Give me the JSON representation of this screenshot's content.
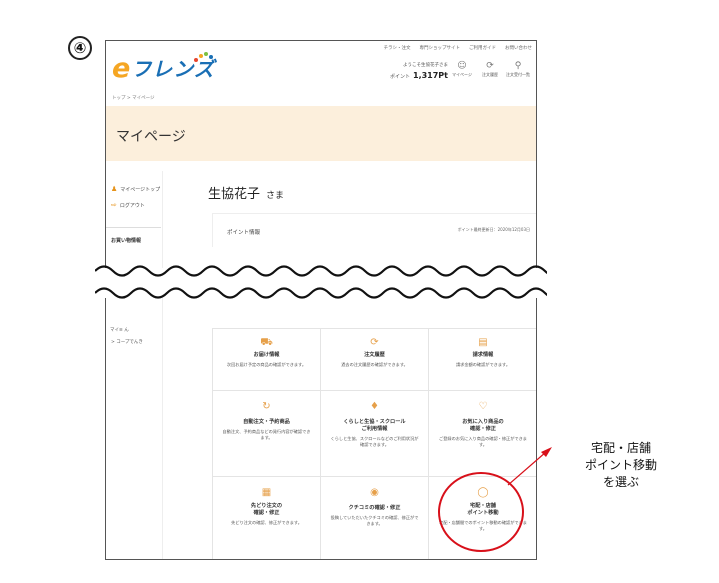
{
  "step_number": "④",
  "logo": {
    "e": "e",
    "rest": "フレンズ"
  },
  "header": {
    "top_links": [
      "チラシ・注文",
      "専門ショップサイト",
      "ご利用ガイド",
      "お問い合わせ"
    ],
    "greeting": "ようこそ生協花子さま",
    "points_label": "ポイント",
    "points_value": "1,317Pt",
    "icons": [
      {
        "icon": "user-icon",
        "label": "マイページ"
      },
      {
        "icon": "history-icon",
        "label": "注文履歴"
      },
      {
        "icon": "cart-icon",
        "label": "注文受付一覧"
      }
    ]
  },
  "breadcrumb": "トップ > マイページ",
  "banner_title": "マイページ",
  "sidebar": {
    "links": [
      {
        "icon": "person-icon",
        "label": "マイページトップ"
      },
      {
        "icon": "logout-icon",
        "label": "ログアウト"
      }
    ],
    "category": "お買い物情報",
    "category2": "マイ≡ ん",
    "coop_link": "> コープでんき"
  },
  "member": {
    "name": "生協花子",
    "honorific": "さま"
  },
  "point_info": {
    "title": "ポイント情報",
    "date": "ポイント最終更新日：2020年12月03日"
  },
  "menu": [
    {
      "icon": "truck-icon",
      "title": "お届け情報",
      "desc": "次回お届け予定の商品の確認ができます。"
    },
    {
      "icon": "history-icon",
      "title": "注文履歴",
      "desc": "過去の注文履歴の確認ができます。"
    },
    {
      "icon": "invoice-icon",
      "title": "請求情報",
      "desc": "請求金額の確認ができます。"
    },
    {
      "icon": "repeat-icon",
      "title": "自動注文・予約商品",
      "desc": "自動注文、予約商品などの発行内容が確認できます。"
    },
    {
      "icon": "bag-icon",
      "title": "くらしと生協・スクロール\nご利用情報",
      "desc": "くらしと生協、スクロールなどのご利用状況が確認できます。"
    },
    {
      "icon": "heart-icon",
      "title": "お気に入り商品の\n確認・修正",
      "desc": "ご登録のお気に入り商品の確認・修正ができます。"
    },
    {
      "icon": "calendar-icon",
      "title": "先どり注文の\n確認・修正",
      "desc": "先どり注文の確認、修正ができます。"
    },
    {
      "icon": "chat-icon",
      "title": "クチコミの確認・修正",
      "desc": "投稿していただいたクチコミの確認、修正ができます。"
    },
    {
      "icon": "point-icon",
      "title": "宅配・店舗\nポイント移動",
      "desc": "宅配・店舗間でのポイント移動の確認ができます。"
    }
  ],
  "callout": {
    "line1": "宅配・店舗",
    "line2": "ポイント移動",
    "line3": "を選ぶ"
  },
  "colors": {
    "accent": "#e6931b",
    "logo_blue": "#1a6fb5",
    "banner": "#fcefdc",
    "highlight": "#d8101a"
  }
}
